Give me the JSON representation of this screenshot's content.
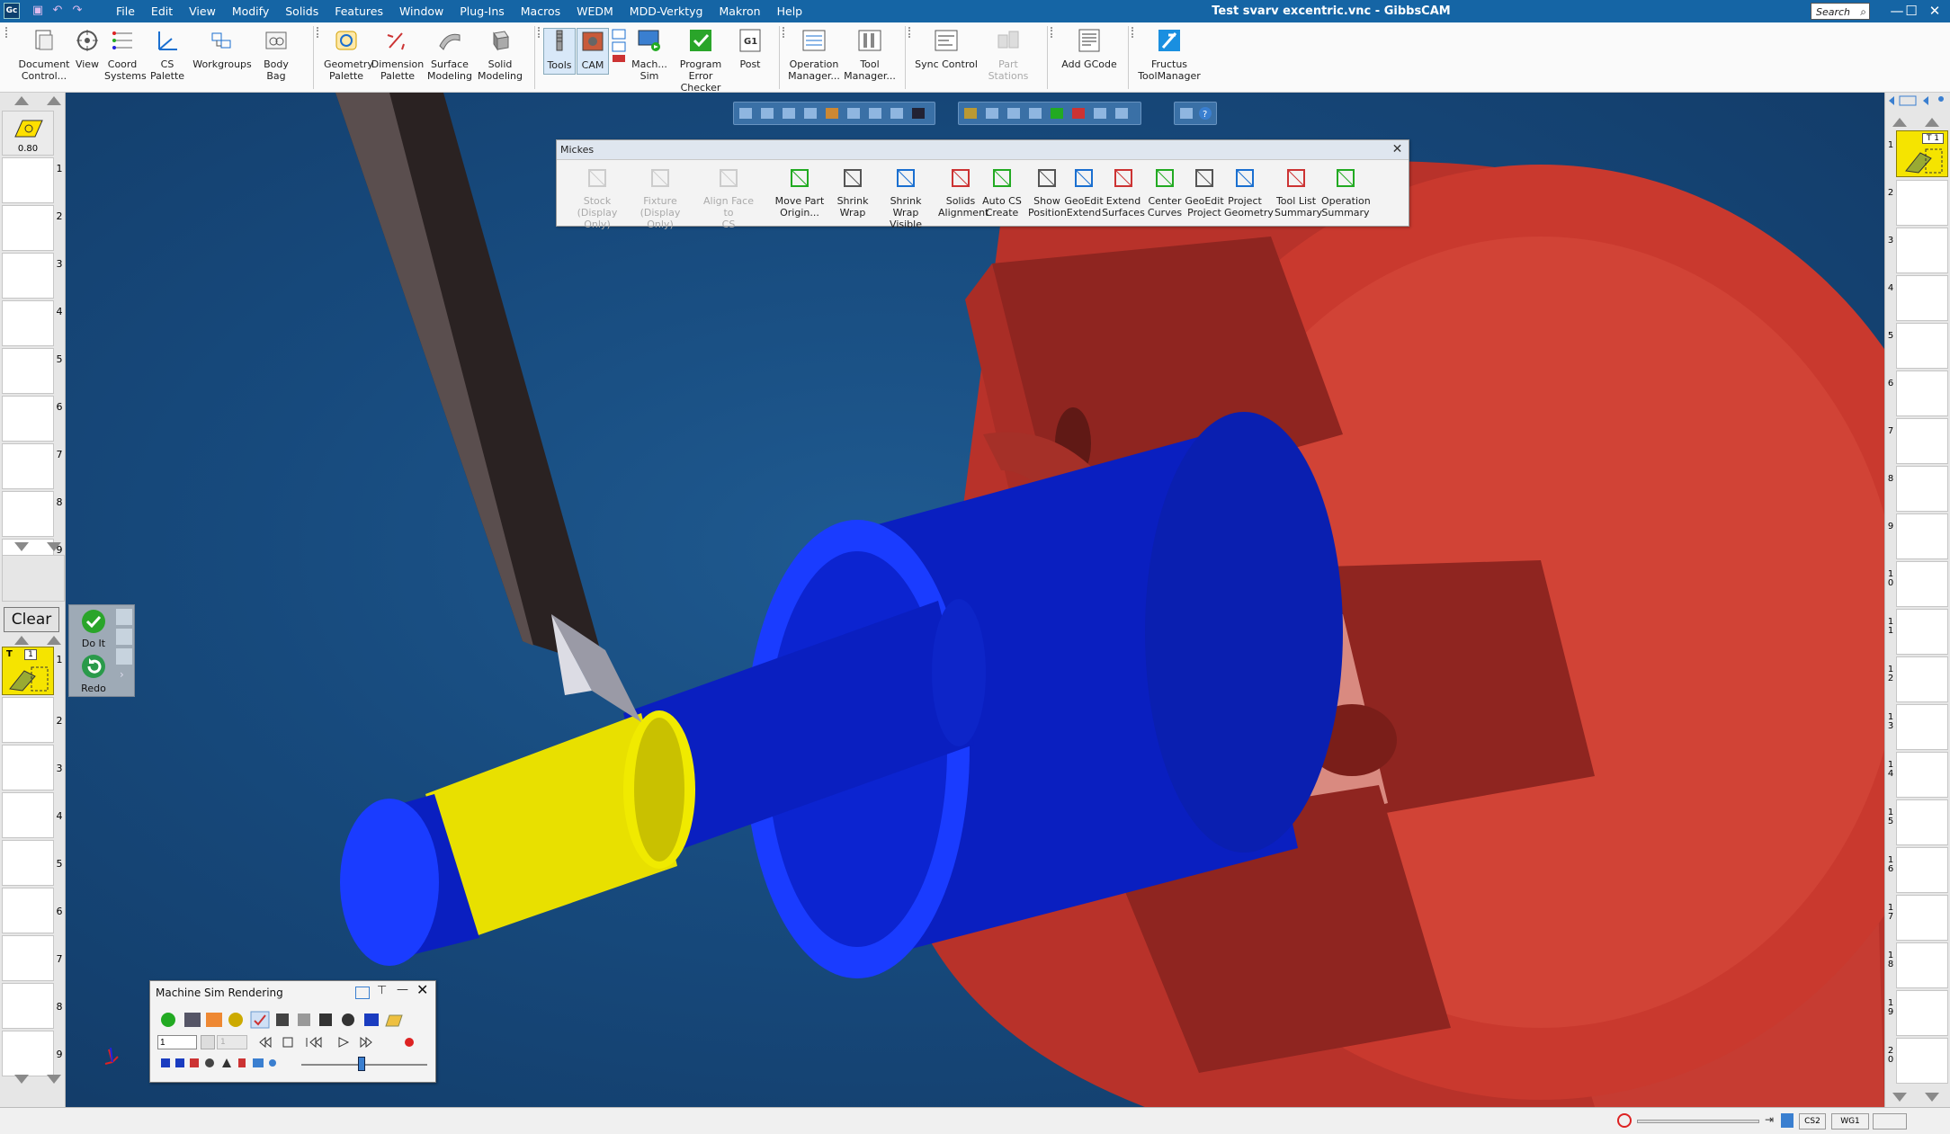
{
  "window": {
    "title": "Test svarv excentric.vnc - GibbsCAM",
    "app_icon": "Gc",
    "search_placeholder": "Search",
    "minimize": "—",
    "maximize": "☐",
    "close": "✕"
  },
  "quick_access": [
    "save-icon",
    "undo-icon",
    "redo-icon"
  ],
  "menu": [
    "File",
    "Edit",
    "View",
    "Modify",
    "Solids",
    "Features",
    "Window",
    "Plug-Ins",
    "Macros",
    "WEDM",
    "MDD-Verktyg",
    "Makron",
    "Help"
  ],
  "ribbon": {
    "groups": [
      {
        "items": [
          {
            "l1": "Document",
            "l2": "Control...",
            "icon": "document-icon"
          },
          {
            "l1": "View",
            "l2": "",
            "icon": "view-icon"
          },
          {
            "l1": "Coord",
            "l2": "Systems",
            "icon": "coord-systems-icon"
          },
          {
            "l1": "CS Palette",
            "l2": "",
            "icon": "cs-palette-icon"
          },
          {
            "l1": "Workgroups",
            "l2": "",
            "icon": "workgroups-icon"
          },
          {
            "l1": "Body Bag",
            "l2": "",
            "icon": "body-bag-icon"
          }
        ]
      },
      {
        "items": [
          {
            "l1": "Geometry",
            "l2": "Palette",
            "icon": "geometry-palette-icon"
          },
          {
            "l1": "Dimension",
            "l2": "Palette",
            "icon": "dimension-palette-icon"
          },
          {
            "l1": "Surface",
            "l2": "Modeling",
            "icon": "surface-modeling-icon"
          },
          {
            "l1": "Solid",
            "l2": "Modeling",
            "icon": "solid-modeling-icon"
          }
        ]
      },
      {
        "items": [
          {
            "l1": "Tools",
            "l2": "",
            "icon": "tools-icon"
          },
          {
            "l1": "CAM",
            "l2": "",
            "icon": "cam-icon"
          },
          {
            "l1": "Mach...",
            "l2": "Sim",
            "icon": "machine-sim-icon"
          },
          {
            "l1": "Program",
            "l2": "Error Checker",
            "icon": "program-checker-icon"
          },
          {
            "l1": "Post",
            "l2": "",
            "icon": "post-icon"
          }
        ]
      },
      {
        "items": [
          {
            "l1": "Operation",
            "l2": "Manager...",
            "icon": "operation-manager-icon"
          },
          {
            "l1": "Tool",
            "l2": "Manager...",
            "icon": "tool-manager-icon"
          }
        ]
      },
      {
        "items": [
          {
            "l1": "Sync Control",
            "l2": "",
            "icon": "sync-control-icon"
          },
          {
            "l1": "Part Stations",
            "l2": "",
            "icon": "part-stations-icon"
          }
        ]
      },
      {
        "items": [
          {
            "l1": "Add GCode",
            "l2": "",
            "icon": "add-gcode-icon"
          }
        ]
      },
      {
        "items": [
          {
            "l1": "Fructus",
            "l2": "ToolManager",
            "icon": "fructus-icon"
          }
        ]
      }
    ]
  },
  "left_panel": {
    "top_value": "0.80",
    "top_slots": [
      "1",
      "2",
      "3",
      "4",
      "5",
      "6",
      "7",
      "8",
      "9"
    ],
    "clear": "Clear",
    "do_it": "Do It",
    "redo": "Redo",
    "tool_label": "T",
    "tool_num": "1",
    "bottom_slots": [
      "1",
      "2",
      "3",
      "4",
      "5",
      "6",
      "7",
      "8",
      "9"
    ]
  },
  "right_panel": {
    "tool_label": "T 1",
    "slots": [
      "1",
      "2",
      "3",
      "4",
      "5",
      "6",
      "7",
      "8",
      "9",
      "1 0",
      "1 1",
      "1 2",
      "1 3",
      "1 4",
      "1 5",
      "1 6",
      "1 7",
      "1 8",
      "1 9",
      "2 0"
    ]
  },
  "mickes": {
    "title": "Mickes",
    "close": "✕",
    "items": [
      {
        "l1": "Stock",
        "l2": "(Display Only)",
        "disabled": true,
        "icon": "stock-icon"
      },
      {
        "l1": "Fixture",
        "l2": "(Display Only)",
        "disabled": true,
        "icon": "fixture-icon"
      },
      {
        "l1": "Align Face to",
        "l2": "CS",
        "disabled": true,
        "icon": "align-face-icon"
      },
      {
        "l1": "Move Part",
        "l2": "Origin...",
        "disabled": false,
        "icon": "move-part-icon"
      },
      {
        "l1": "Shrink Wrap",
        "l2": "",
        "disabled": false,
        "icon": "shrink-wrap-icon"
      },
      {
        "l1": "Shrink Wrap",
        "l2": "Visible",
        "disabled": false,
        "icon": "shrink-wrap-visible-icon"
      },
      {
        "l1": "Solids",
        "l2": "Alignment",
        "disabled": false,
        "icon": "solids-alignment-icon"
      },
      {
        "l1": "Auto CS",
        "l2": "Create",
        "disabled": false,
        "icon": "auto-cs-icon"
      },
      {
        "l1": "Show",
        "l2": "Position",
        "disabled": false,
        "icon": "show-position-icon"
      },
      {
        "l1": "GeoEdit",
        "l2": "Extend",
        "disabled": false,
        "icon": "geoedit-extend-icon"
      },
      {
        "l1": "Extend",
        "l2": "Surfaces",
        "disabled": false,
        "icon": "extend-surfaces-icon"
      },
      {
        "l1": "Center",
        "l2": "Curves",
        "disabled": false,
        "icon": "center-curves-icon"
      },
      {
        "l1": "GeoEdit",
        "l2": "Project",
        "disabled": false,
        "icon": "geoedit-project-icon"
      },
      {
        "l1": "Project",
        "l2": "Geometry",
        "disabled": false,
        "icon": "project-geometry-icon"
      },
      {
        "l1": "Tool List",
        "l2": "Summary",
        "disabled": false,
        "icon": "tool-list-icon"
      },
      {
        "l1": "Operation",
        "l2": "Summary",
        "disabled": false,
        "icon": "operation-summary-icon"
      }
    ]
  },
  "machine_sim": {
    "title": "Machine Sim Rendering",
    "step_value": "1",
    "step_value2": "1",
    "slider_position": 0.48
  },
  "status": {
    "cs": "CS2",
    "wg": "WG1"
  },
  "colors": {
    "titlebar": "#1565a5",
    "viewport": "#174a7d",
    "chuck": "#c8352b",
    "part": "#0a1fc0",
    "yellow_feature": "#e8e000",
    "tool_holder": "#2a2222"
  }
}
